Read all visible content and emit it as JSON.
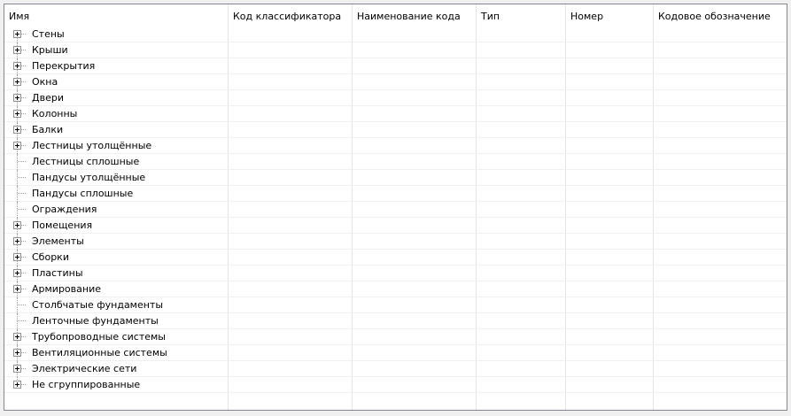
{
  "columns": [
    "Имя",
    "Код классификатора",
    "Наименование кода",
    "Тип",
    "Номер",
    "Кодовое обозначение"
  ],
  "rows": [
    {
      "label": "Стены",
      "expandable": true
    },
    {
      "label": "Крыши",
      "expandable": true
    },
    {
      "label": "Перекрытия",
      "expandable": true
    },
    {
      "label": "Окна",
      "expandable": true
    },
    {
      "label": "Двери",
      "expandable": true
    },
    {
      "label": "Колонны",
      "expandable": true
    },
    {
      "label": "Балки",
      "expandable": true
    },
    {
      "label": "Лестницы утолщённые",
      "expandable": true
    },
    {
      "label": "Лестницы сплошные",
      "expandable": false
    },
    {
      "label": "Пандусы утолщённые",
      "expandable": false
    },
    {
      "label": "Пандусы сплошные",
      "expandable": false
    },
    {
      "label": "Ограждения",
      "expandable": false
    },
    {
      "label": "Помещения",
      "expandable": true
    },
    {
      "label": "Элементы",
      "expandable": true
    },
    {
      "label": "Сборки",
      "expandable": true
    },
    {
      "label": "Пластины",
      "expandable": true
    },
    {
      "label": "Армирование",
      "expandable": true
    },
    {
      "label": "Столбчатые фундаменты",
      "expandable": false
    },
    {
      "label": "Ленточные фундаменты",
      "expandable": false
    },
    {
      "label": "Трубопроводные системы",
      "expandable": true
    },
    {
      "label": "Вентиляционные системы",
      "expandable": true
    },
    {
      "label": "Электрические сети",
      "expandable": true
    },
    {
      "label": "Не сгруппированные",
      "expandable": true
    }
  ]
}
